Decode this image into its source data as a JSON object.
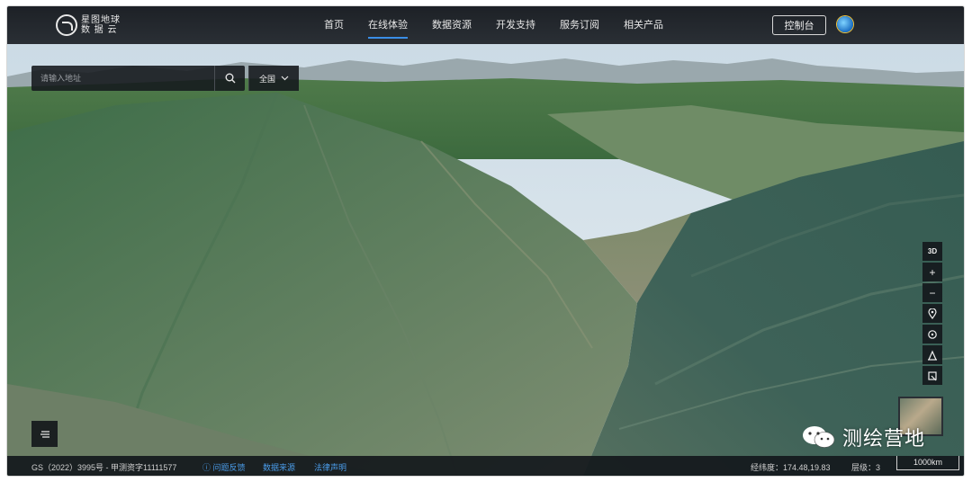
{
  "header": {
    "logo_line1": "星图地球",
    "logo_line2": "数 据 云",
    "nav": [
      {
        "label": "首页",
        "active": false
      },
      {
        "label": "在线体验",
        "active": true
      },
      {
        "label": "数据资源",
        "active": false
      },
      {
        "label": "开发支持",
        "active": false
      },
      {
        "label": "服务订阅",
        "active": false
      },
      {
        "label": "相关产品",
        "active": false
      }
    ],
    "console_label": "控制台",
    "avatar_icon": "globe-icon"
  },
  "search": {
    "placeholder": "请输入地址",
    "icon": "search-icon",
    "region": "全国"
  },
  "map_tools": [
    {
      "name": "3d-toggle",
      "label": "3D",
      "icon": "rotate-3d-icon"
    },
    {
      "name": "zoom-in",
      "label": "+",
      "icon": "plus-icon"
    },
    {
      "name": "zoom-out",
      "label": "−",
      "icon": "minus-icon"
    },
    {
      "name": "location",
      "label": "",
      "icon": "map-pin-icon"
    },
    {
      "name": "locate-me",
      "label": "",
      "icon": "crosshair-icon"
    },
    {
      "name": "measure",
      "label": "",
      "icon": "measure-icon"
    },
    {
      "name": "clear",
      "label": "",
      "icon": "eraser-icon"
    }
  ],
  "footer": {
    "license": "GS（2022）3995号 - 甲测资字11111577",
    "feedback": "问题反馈",
    "data_source": "数据来源",
    "legal": "法律声明",
    "coords_label": "经纬度：",
    "coords": "174.48,19.83",
    "level_label": "层级：",
    "level": "3",
    "scale": "1000km"
  },
  "watermark": {
    "text": "测绘营地",
    "icon": "wechat-icon"
  },
  "colors": {
    "active_nav": "#3a8ee6",
    "link": "#4a9be8",
    "bar_bg": "#1d2126"
  }
}
